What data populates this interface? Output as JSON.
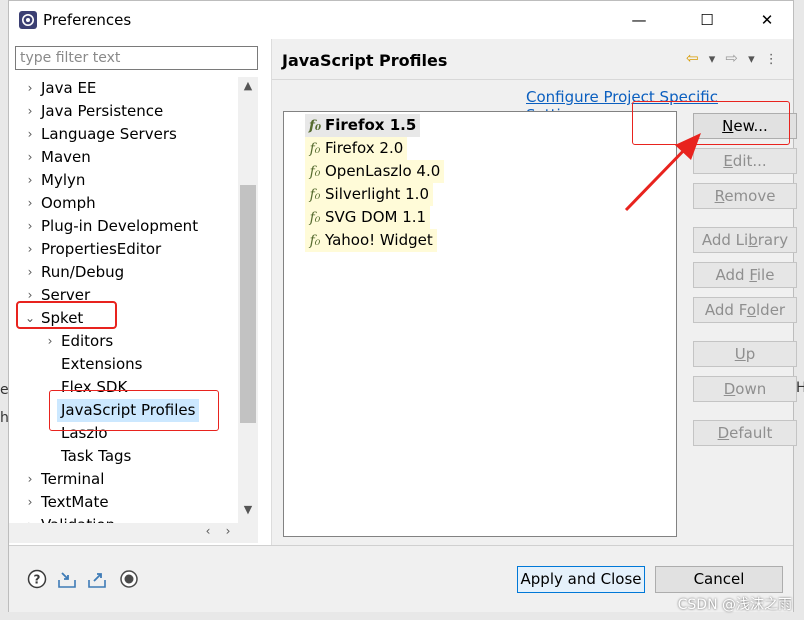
{
  "window": {
    "title": "Preferences",
    "min": "—",
    "max": "☐",
    "close": "✕"
  },
  "filter": {
    "placeholder": "type filter text"
  },
  "tree": {
    "items": [
      {
        "label": "Java EE",
        "twisty": "›"
      },
      {
        "label": "Java Persistence",
        "twisty": "›"
      },
      {
        "label": "Language Servers",
        "twisty": "›"
      },
      {
        "label": "Maven",
        "twisty": "›"
      },
      {
        "label": "Mylyn",
        "twisty": "›"
      },
      {
        "label": "Oomph",
        "twisty": "›"
      },
      {
        "label": "Plug-in Development",
        "twisty": "›"
      },
      {
        "label": "PropertiesEditor",
        "twisty": "›"
      },
      {
        "label": "Run/Debug",
        "twisty": "›"
      },
      {
        "label": "Server",
        "twisty": "›"
      },
      {
        "label": "Spket",
        "twisty": "⌄"
      },
      {
        "label": "Editors",
        "twisty": "›"
      },
      {
        "label": "Extensions",
        "twisty": ""
      },
      {
        "label": "Flex SDK",
        "twisty": ""
      },
      {
        "label": "JavaScript Profiles",
        "twisty": ""
      },
      {
        "label": "Laszlo",
        "twisty": ""
      },
      {
        "label": "Task Tags",
        "twisty": ""
      },
      {
        "label": "Terminal",
        "twisty": "›"
      },
      {
        "label": "TextMate",
        "twisty": "›"
      },
      {
        "label": "Validation",
        "twisty": "›"
      }
    ]
  },
  "page": {
    "title": "JavaScript Profiles",
    "configure_link": "Configure Project Specific Settings...",
    "nav": {
      "back": "⇦",
      "fwd": "⇨",
      "dropdown": "▾"
    }
  },
  "profiles": [
    {
      "label": "Firefox 1.5",
      "icon": "fo-icon"
    },
    {
      "label": "Firefox 2.0",
      "icon": "fo-icon"
    },
    {
      "label": "OpenLaszlo 4.0",
      "icon": "fo-icon"
    },
    {
      "label": "Silverlight 1.0",
      "icon": "fo-icon"
    },
    {
      "label": "SVG DOM 1.1",
      "icon": "fo-icon"
    },
    {
      "label": "Yahoo! Widget",
      "icon": "fo-icon"
    }
  ],
  "profile_icon_glyph": "f₀",
  "buttons": {
    "new": {
      "pre": "",
      "u": "N",
      "post": "ew..."
    },
    "edit": {
      "pre": "",
      "u": "E",
      "post": "dit..."
    },
    "remove": {
      "pre": "",
      "u": "R",
      "post": "emove"
    },
    "add_library": {
      "pre": "Add Li",
      "u": "b",
      "post": "rary"
    },
    "add_file": {
      "pre": "Add ",
      "u": "F",
      "post": "ile"
    },
    "add_folder": {
      "pre": "Add F",
      "u": "o",
      "post": "lder"
    },
    "up": {
      "pre": "",
      "u": "U",
      "post": "p"
    },
    "down": {
      "pre": "",
      "u": "D",
      "post": "own"
    },
    "default": {
      "pre": "",
      "u": "D",
      "post": "efault"
    }
  },
  "footer": {
    "apply_close": "Apply and Close",
    "cancel": "Cancel"
  },
  "watermark": "CSDN @浅沫之雨",
  "colors": {
    "accent": "#0078d7",
    "annotation": "#e8231e",
    "link": "#0b5fbf",
    "selection": "#cce8ff"
  }
}
